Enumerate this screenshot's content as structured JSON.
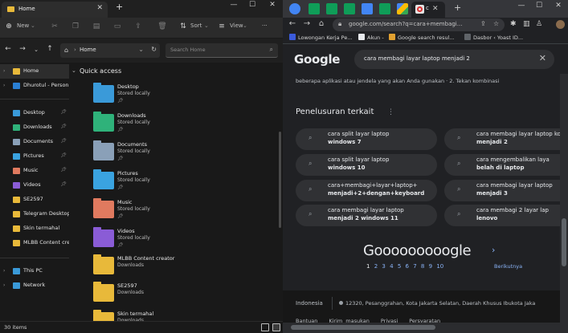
{
  "explorer": {
    "tab_title": "Home",
    "toolbar": {
      "new_label": "New",
      "sort_label": "Sort",
      "view_label": "View"
    },
    "address": {
      "path": "Home",
      "search_placeholder": "Search Home"
    },
    "sidebar": {
      "items": [
        {
          "label": "Home",
          "selected": true
        },
        {
          "label": "Dhurotul - Persona"
        },
        {
          "label": "Desktop",
          "pinned": true
        },
        {
          "label": "Downloads",
          "pinned": true
        },
        {
          "label": "Documents",
          "pinned": true
        },
        {
          "label": "Pictures",
          "pinned": true
        },
        {
          "label": "Music",
          "pinned": true
        },
        {
          "label": "Videos",
          "pinned": true
        },
        {
          "label": "SE2597"
        },
        {
          "label": "Telegram Desktop"
        },
        {
          "label": "Skin termahal"
        },
        {
          "label": "MLBB Content crea"
        },
        {
          "label": "This PC"
        },
        {
          "label": "Network"
        }
      ]
    },
    "quick_access": {
      "title": "Quick access",
      "folders": [
        {
          "name": "Desktop",
          "sub": "Stored locally",
          "color": "#3a9ad9"
        },
        {
          "name": "Downloads",
          "sub": "Stored locally",
          "color": "#2fb27a"
        },
        {
          "name": "Documents",
          "sub": "Stored locally",
          "color": "#8aa0b8"
        },
        {
          "name": "Pictures",
          "sub": "Stored locally",
          "color": "#3aa3e0"
        },
        {
          "name": "Music",
          "sub": "Stored locally",
          "color": "#e07a5f"
        },
        {
          "name": "Videos",
          "sub": "Stored locally",
          "color": "#8a5cd6"
        },
        {
          "name": "MLBB Content creator",
          "sub": "Downloads",
          "color": "#e8b93a"
        },
        {
          "name": "SE2597",
          "sub": "Downloads",
          "color": "#e8b93a"
        },
        {
          "name": "Skin termahal",
          "sub": "Downloads",
          "color": "#e8b93a"
        }
      ]
    },
    "status": {
      "items": "30 items"
    }
  },
  "chrome": {
    "url": "google.com/search?q=cara+membagi...",
    "bookmarks": [
      {
        "label": "Lowongan Kerja Pe...",
        "color": "#3b5bdb"
      },
      {
        "label": "Akun -",
        "color": "#e8eaed"
      },
      {
        "label": "Google search resul...",
        "color": "#e0a030"
      },
      {
        "label": "Dasbor ‹ Yoast ID...",
        "color": "#5f6368"
      }
    ],
    "google": {
      "logo": "Google",
      "query": "cara membagi layar laptop menjadi 2",
      "snippet": "beberapa aplikasi atau jendela yang akan Anda gunakan · 2. Tekan kombinasi",
      "related_title": "Penelusuran terkait",
      "related": [
        {
          "l1": "cara split layar laptop",
          "l2": "windows 7"
        },
        {
          "l1": "cara membagi layar laptop komp",
          "l2": "menjadi 2"
        },
        {
          "l1": "cara split layar laptop",
          "l2": "windows 10"
        },
        {
          "l1": "cara mengembalikan laya",
          "l2": "belah di laptop"
        },
        {
          "l1": "cara+membagi+layar+laptop+",
          "l2": "menjadi+2+dengan+keyboard"
        },
        {
          "l1": "cara membagi layar laptop",
          "l2": "menjadi 3"
        },
        {
          "l1": "cara membagi layar laptop",
          "l2": "menjadi 2 windows 11"
        },
        {
          "l1": "cara membagi 2 layar lap",
          "l2": "lenovo"
        }
      ],
      "pagination_logo": "Gooooooooogle",
      "pages": [
        "1",
        "2",
        "3",
        "4",
        "5",
        "6",
        "7",
        "8",
        "9",
        "10"
      ],
      "next_label": "Berikutnya",
      "footer_country": "Indonesia",
      "footer_location": "12320, Pesanggrahan, Kota Jakarta Selatan, Daerah Khusus Ibukota Jaka",
      "footer_links": [
        "Bantuan",
        "Kirim masukan",
        "Privasi",
        "Persyaratan"
      ]
    }
  }
}
